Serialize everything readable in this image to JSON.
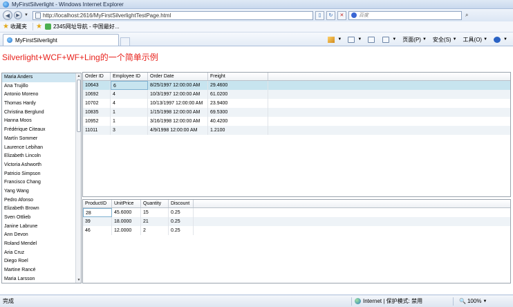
{
  "window": {
    "title": "MyFirstSilverlight - Windows Internet Explorer"
  },
  "address_bar": {
    "url": "http://localhost:2616/MyFirstSilverlightTestPage.html",
    "search_placeholder": "百度"
  },
  "favorites_bar": {
    "favorites_label": "收藏夹",
    "link_label": "2345网址导航 - 中国最好..."
  },
  "tab": {
    "label": "MyFirstSilverlight"
  },
  "command_bar": {
    "page_label": "页面(P)",
    "safety_label": "安全(S)",
    "tools_label": "工具(O)"
  },
  "page": {
    "heading": "Silverlight+WCF+WF+Ling的一个简单示例"
  },
  "employees": [
    "Maria Anders",
    "Ana Trujillo",
    "Antonio Moreno",
    "Thomas Hardy",
    "Christina Berglund",
    "Hanna Moos",
    "Frédérique Citeaux",
    "Martín Sommer",
    "Laurence Lebihan",
    "Elizabeth Lincoln",
    "Victoria Ashworth",
    "Patricio Simpson",
    "Francisco Chang",
    "Yang Wang",
    "Pedro Afonso",
    "Elizabeth Brown",
    "Sven Ottlieb",
    "Janine Labrune",
    "Ann Devon",
    "Roland Mendel",
    "Aria Cruz",
    "Diego Roel",
    "Martine Rancé",
    "Maria Larsson"
  ],
  "orders": {
    "columns": [
      "Order ID",
      "Employee ID",
      "Order Date",
      "Freight"
    ],
    "rows": [
      [
        "10643",
        "6",
        "8/25/1997 12:00:00 AM",
        "29.4600"
      ],
      [
        "10692",
        "4",
        "10/3/1997 12:00:00 AM",
        "61.0200"
      ],
      [
        "10702",
        "4",
        "10/13/1997 12:00:00 AM",
        "23.9400"
      ],
      [
        "10835",
        "1",
        "1/15/1998 12:00:00 AM",
        "69.5300"
      ],
      [
        "10952",
        "1",
        "3/16/1998 12:00:00 AM",
        "40.4200"
      ],
      [
        "11011",
        "3",
        "4/9/1998 12:00:00 AM",
        "1.2100"
      ]
    ]
  },
  "order_details": {
    "columns": [
      "ProductID",
      "UnitPrice",
      "Quantity",
      "Discount"
    ],
    "rows": [
      [
        "28",
        "45.6000",
        "15",
        "0.25"
      ],
      [
        "39",
        "18.0000",
        "21",
        "0.25"
      ],
      [
        "46",
        "12.0000",
        "2",
        "0.25"
      ]
    ]
  },
  "status_bar": {
    "status": "完成",
    "zone": "Internet | 保护模式: 禁用",
    "zoom": "100%"
  }
}
